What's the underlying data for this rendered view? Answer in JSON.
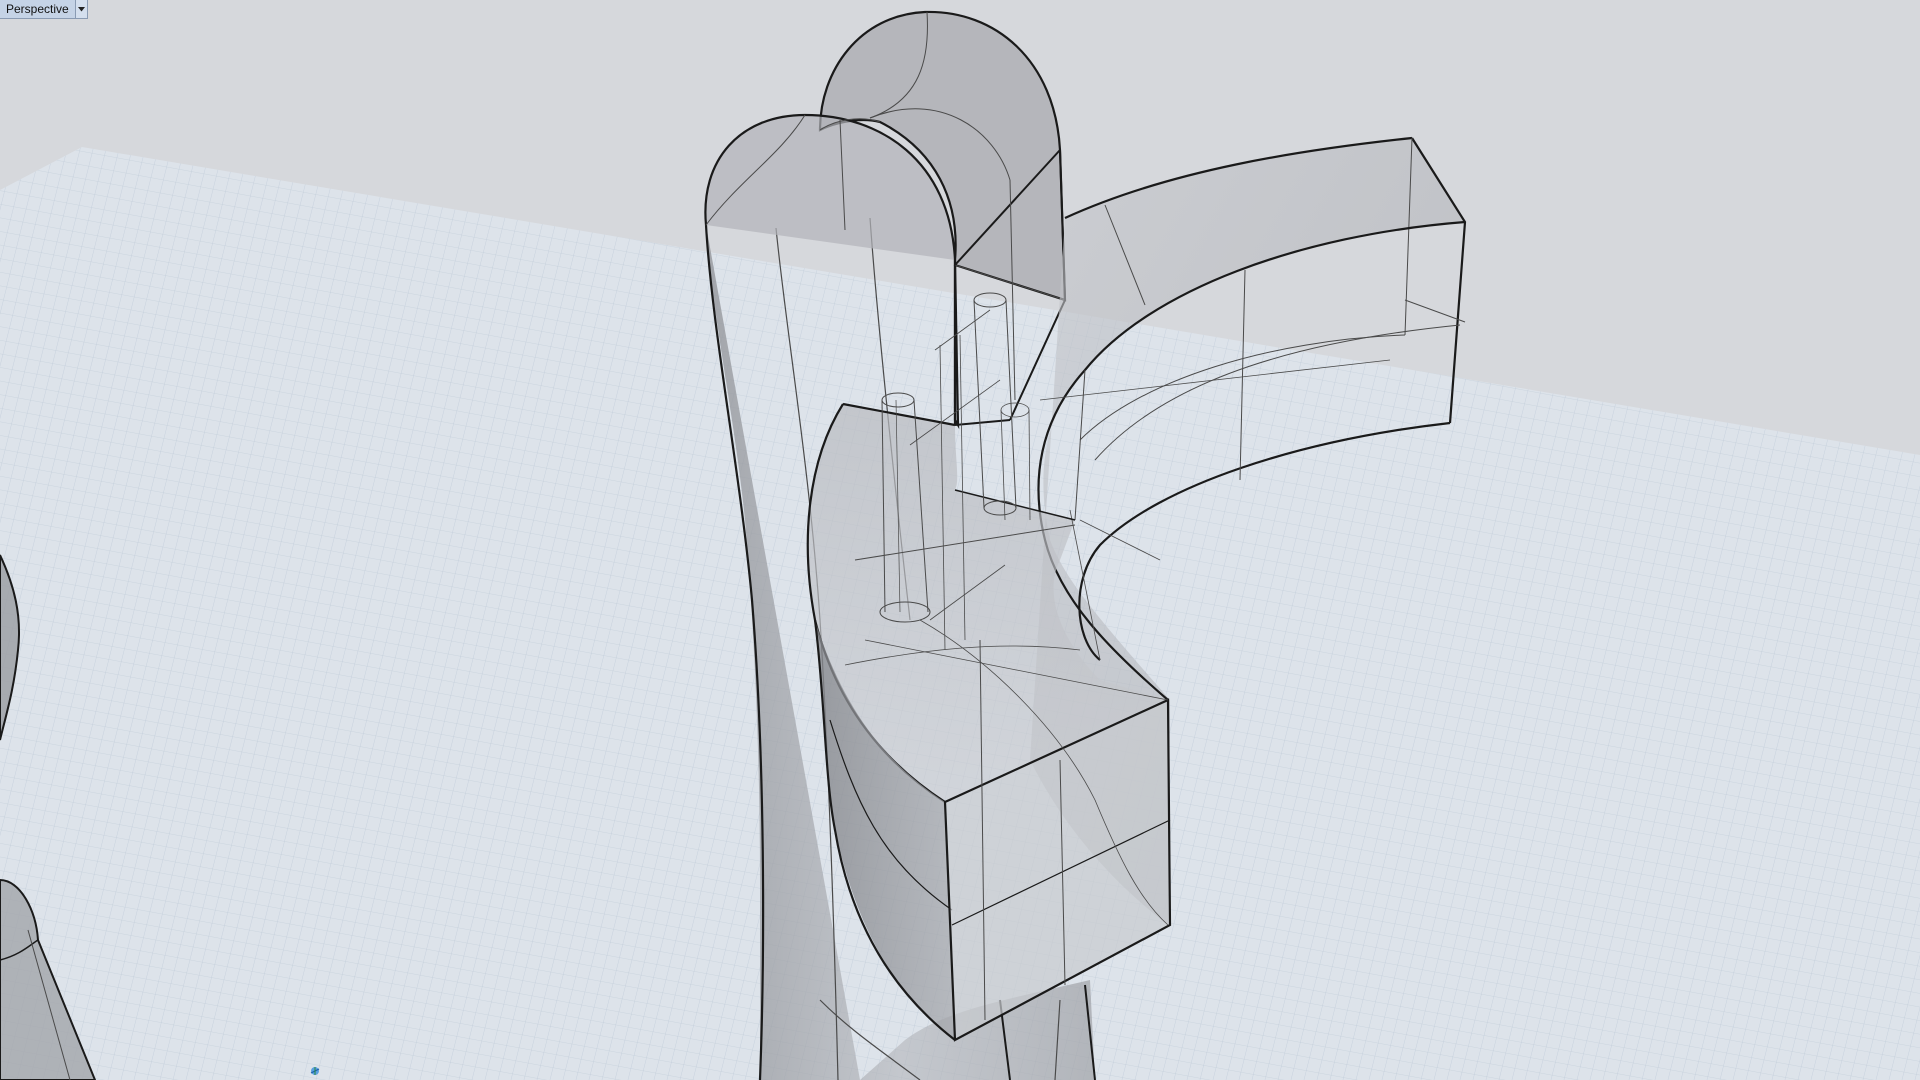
{
  "viewport": {
    "title": "Perspective",
    "dropdown_icon": "chevron-down-icon",
    "view_type": "perspective",
    "display_mode": "ghosted",
    "grid": true
  },
  "colors": {
    "background": "#d6d8dc",
    "grid_plane": "#dde3ea",
    "grid_line": "#a9b8c9",
    "object_fill": "#a2a4a9",
    "object_edge": "#1a1a1a",
    "title_tab": "#c5d3e6"
  },
  "scene": {
    "objects": [
      "vertical-curved-support",
      "arched-top-block",
      "curved-arm",
      "cylindrical-holes",
      "partial-cylinder-left"
    ]
  }
}
